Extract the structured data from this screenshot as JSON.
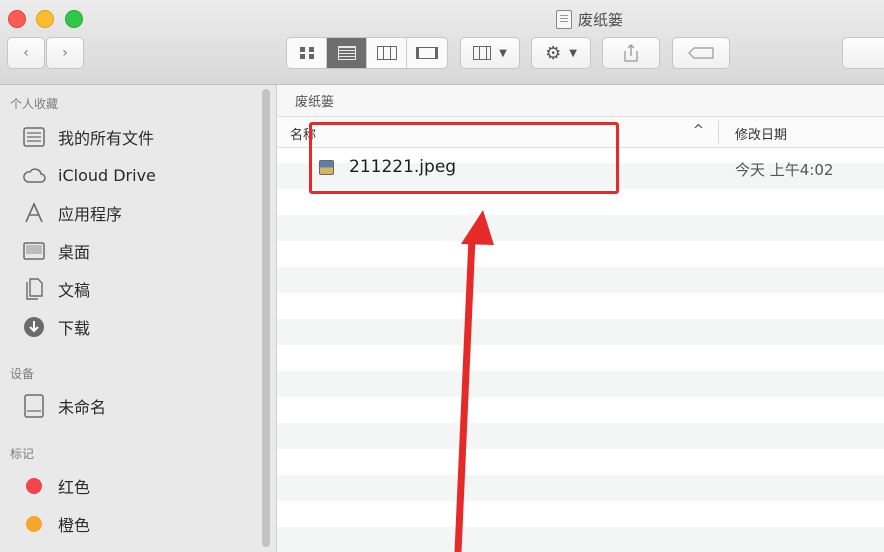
{
  "window": {
    "title": "废纸篓"
  },
  "toolbar": {
    "back_icon": "chevron-left-icon",
    "forward_icon": "chevron-right-icon",
    "view_modes": [
      "icon-view-icon",
      "list-view-icon",
      "column-view-icon",
      "cover-flow-icon"
    ],
    "active_view": "list",
    "arrange_icon": "arrange-grid-icon",
    "action_icon": "gear-icon",
    "share_icon": "share-icon",
    "tag_icon": "tag-icon"
  },
  "sidebar": {
    "favorites_header": "个人收藏",
    "favorites": [
      {
        "label": "我的所有文件",
        "icon": "all-files-icon"
      },
      {
        "label": "iCloud Drive",
        "icon": "cloud-icon"
      },
      {
        "label": "应用程序",
        "icon": "applications-icon"
      },
      {
        "label": "桌面",
        "icon": "desktop-icon"
      },
      {
        "label": "文稿",
        "icon": "documents-icon"
      },
      {
        "label": "下载",
        "icon": "download-icon"
      }
    ],
    "devices_header": "设备",
    "devices": [
      {
        "label": "未命名",
        "icon": "disk-icon"
      }
    ],
    "tags_header": "标记",
    "tags": [
      {
        "label": "红色",
        "color": "#f0454b"
      },
      {
        "label": "橙色",
        "color": "#f8a62b"
      }
    ]
  },
  "main": {
    "path": "废纸篓",
    "columns": {
      "name": "名称",
      "sort_indicator": "^",
      "date_modified": "修改日期"
    },
    "files": [
      {
        "name": "211221.jpeg",
        "date": "今天 上午4:02",
        "icon": "jpeg-file-icon"
      }
    ]
  },
  "annotation": {
    "highlight_color": "#e62a2a"
  }
}
